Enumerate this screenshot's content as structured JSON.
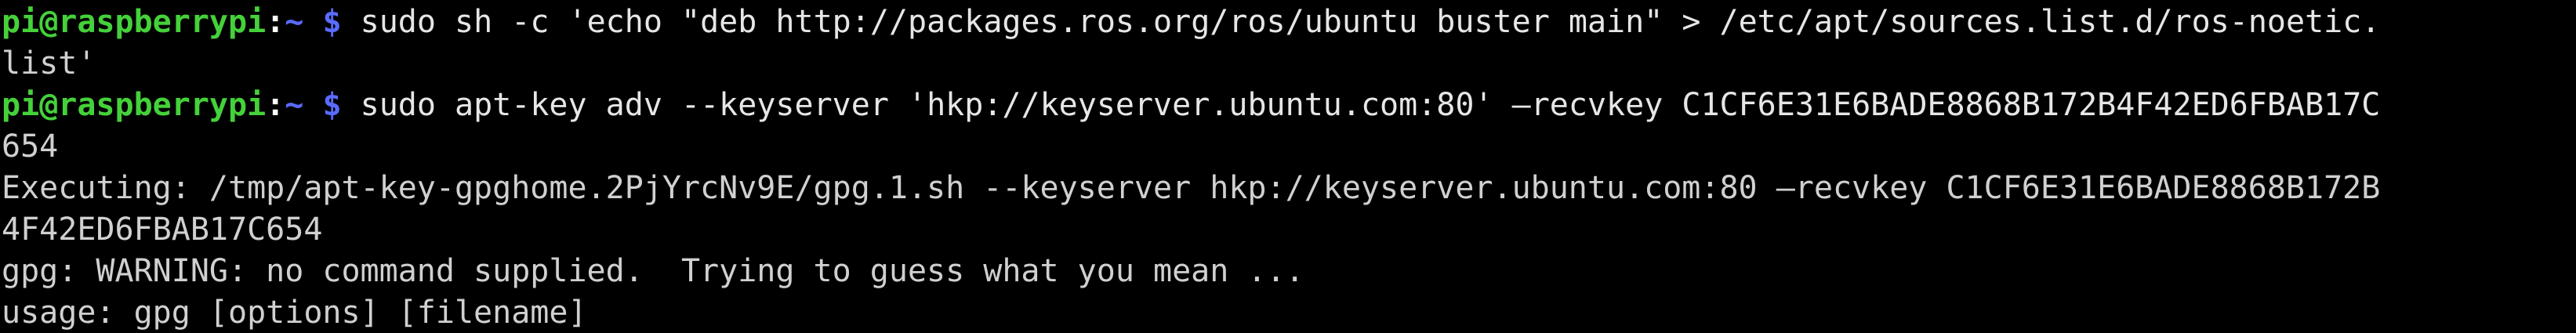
{
  "terminal": {
    "prompt": {
      "user_host": "pi@raspberrypi",
      "separator": ":",
      "path": "~",
      "symbol": "$"
    },
    "colors": {
      "background": "#000000",
      "prompt_user": "#45d13a",
      "prompt_path": "#5a6bff",
      "text": "#d0d0d0"
    },
    "lines": [
      {
        "type": "command",
        "text": " sudo sh -c 'echo \"deb http://packages.ros.org/ros/ubuntu buster main\" > /etc/apt/sources.list.d/ros-noetic."
      },
      {
        "type": "output",
        "text": "list'"
      },
      {
        "type": "command",
        "text": " sudo apt-key adv --keyserver 'hkp://keyserver.ubuntu.com:80' –recvkey C1CF6E31E6BADE8868B172B4F42ED6FBAB17C"
      },
      {
        "type": "output",
        "text": "654"
      },
      {
        "type": "output",
        "text": "Executing: /tmp/apt-key-gpghome.2PjYrcNv9E/gpg.1.sh --keyserver hkp://keyserver.ubuntu.com:80 –recvkey C1CF6E31E6BADE8868B172B"
      },
      {
        "type": "output",
        "text": "4F42ED6FBAB17C654"
      },
      {
        "type": "output",
        "text": "gpg: WARNING: no command supplied.  Trying to guess what you mean ..."
      },
      {
        "type": "output",
        "text": "usage: gpg [options] [filename]"
      }
    ]
  }
}
